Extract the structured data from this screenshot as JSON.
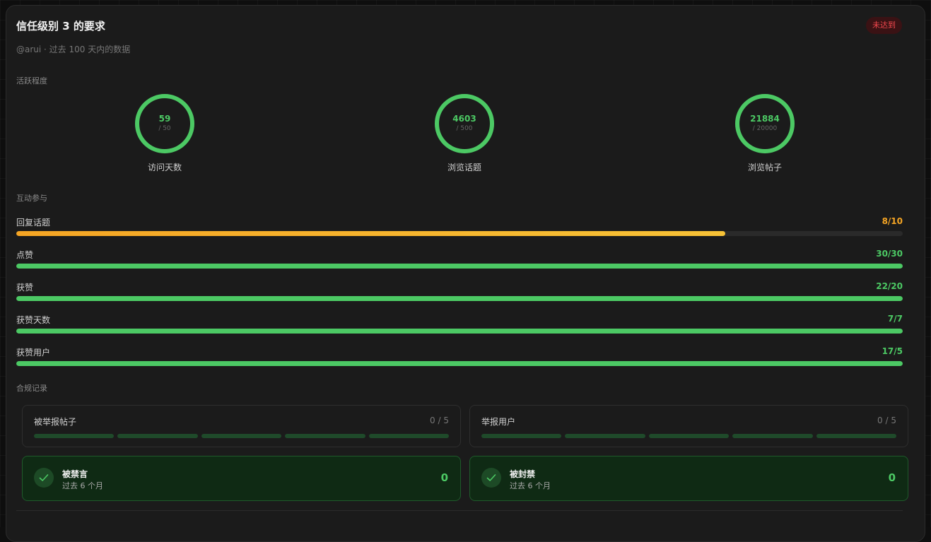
{
  "header": {
    "title": "信任级别 3 的要求",
    "status_badge": "未达到",
    "subtitle": "@arui · 过去 100 天内的数据"
  },
  "sections": {
    "activity": "活跃程度",
    "engagement": "互动参与",
    "compliance": "合规记录"
  },
  "rings": [
    {
      "value": "59",
      "target": "/ 50",
      "label": "访问天数",
      "progress": 1.0
    },
    {
      "value": "4603",
      "target": "/ 500",
      "label": "浏览话题",
      "progress": 1.0
    },
    {
      "value": "21884",
      "target": "/ 20000",
      "label": "浏览帖子",
      "progress": 1.0
    }
  ],
  "bars": [
    {
      "label": "回复话题",
      "value": "8/10",
      "progress": 0.8,
      "status": "warning"
    },
    {
      "label": "点赞",
      "value": "30/30",
      "progress": 1.0,
      "status": "ok"
    },
    {
      "label": "获赞",
      "value": "22/20",
      "progress": 1.0,
      "status": "ok"
    },
    {
      "label": "获赞天数",
      "value": "7/7",
      "progress": 1.0,
      "status": "ok"
    },
    {
      "label": "获赞用户",
      "value": "17/5",
      "progress": 1.0,
      "status": "ok"
    }
  ],
  "compliance": {
    "flagged_posts": {
      "label": "被举报帖子",
      "count": "0 / 5"
    },
    "flagged_users": {
      "label": "举报用户",
      "count": "0 / 5"
    },
    "silenced": {
      "label": "被禁言",
      "sub": "过去 6 个月",
      "value": "0"
    },
    "suspended": {
      "label": "被封禁",
      "sub": "过去 6 个月",
      "value": "0"
    }
  },
  "colors": {
    "ok": "#4cc964",
    "warning": "#f5a524",
    "danger": "#f0474d"
  }
}
